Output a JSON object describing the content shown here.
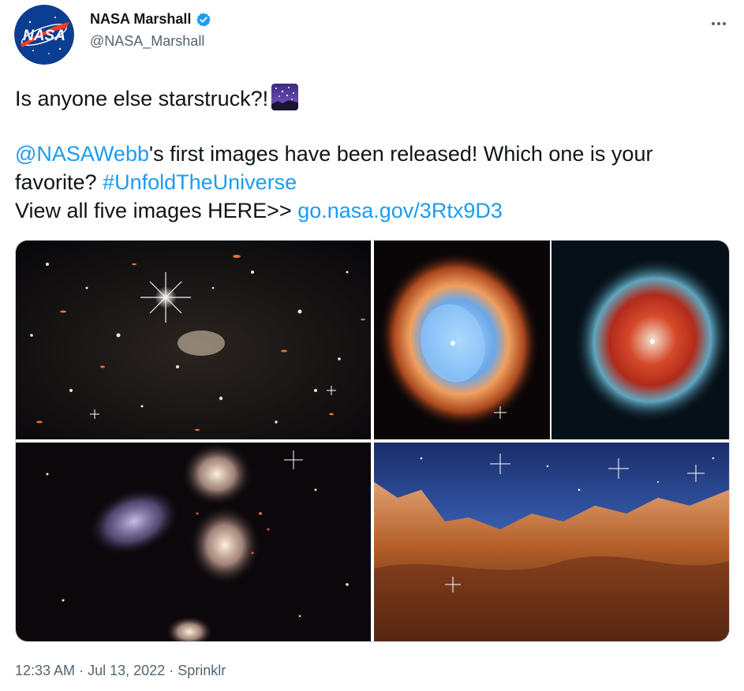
{
  "author": {
    "display_name": "NASA Marshall",
    "handle": "@NASA_Marshall",
    "avatar_text": "NASA",
    "verified_icon": "verified-badge-icon",
    "verified_color": "#1d9bf0"
  },
  "more_icon": "more-dots-icon",
  "tweet": {
    "line1": "Is anyone else starstruck?!",
    "emoji": "milky-way-emoji",
    "mention": "@NASAWebb",
    "line2_rest": "'s first images have been released! Which one is your",
    "line3_text": "favorite?",
    "hashtag": "#UnfoldTheUniverse",
    "line4_text": "View all five images HERE>>",
    "link": "go.nasa.gov/3Rtx9D3"
  },
  "images": [
    {
      "subject": "deep-field-galaxies"
    },
    {
      "subject": "southern-ring-nebula-near-infrared"
    },
    {
      "subject": "southern-ring-nebula-mid-infrared"
    },
    {
      "subject": "stephans-quintet"
    },
    {
      "subject": "cosmic-cliffs-carina-nebula"
    }
  ],
  "meta": {
    "time": "12:33 AM",
    "date": "Jul 13, 2022",
    "source": "Sprinklr",
    "separator": "·"
  },
  "colors": {
    "link": "#1d9bf0",
    "text": "#0f1419",
    "muted": "#536471",
    "border": "#cfd9de"
  }
}
